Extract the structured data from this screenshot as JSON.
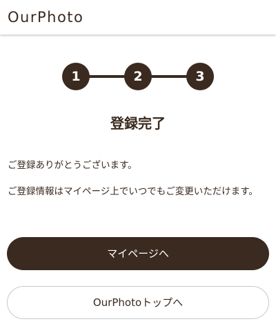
{
  "header": {
    "logo": "OurPhoto"
  },
  "stepper": {
    "steps": [
      "1",
      "2",
      "3"
    ]
  },
  "main": {
    "title": "登録完了",
    "message_1": "ご登録ありがとうございます。",
    "message_2": "ご登録情報はマイページ上でいつでもご変更いただけます。"
  },
  "actions": {
    "mypage_label": "マイページへ",
    "top_label": "OurPhotoトップへ"
  },
  "colors": {
    "brand": "#3a2a1f",
    "background": "#ffffff",
    "border": "#c8c8c8"
  }
}
